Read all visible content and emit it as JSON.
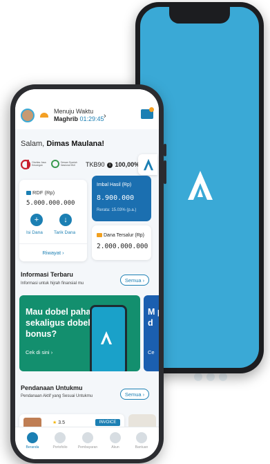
{
  "header": {
    "line1": "Menuju Waktu",
    "prayer": "Maghrib",
    "countdown": "01:29:45",
    "chevron": "›"
  },
  "greeting": {
    "prefix": "Salam,",
    "name": "Dimas Maulana!"
  },
  "licenses": {
    "ojk_text": "Otoritas Jasa Keuangan",
    "mui_text": "Dewan Syariah Nasional MUI"
  },
  "tkb": {
    "label": "TKB90",
    "info_icon": "i",
    "value": "100,00%"
  },
  "rdf": {
    "label": "RDF (Rp)",
    "value": "5.000.000.000",
    "isi_label": "Isi Dana",
    "tarik_label": "Tarik Dana",
    "riwayat": "Riwayat",
    "plus_glyph": "+",
    "down_glyph": "↓"
  },
  "imbal": {
    "label": "Imbal Hasil (Rp)",
    "value": "8.900.000",
    "rerata": "Rerata: 15.03% (p.a.)"
  },
  "tersalur": {
    "label": "Dana Tersalur (Rp)",
    "value": "2.000.000.000"
  },
  "info_section": {
    "title": "Informasi Terbaru",
    "subtitle": "Informasi untuk hijrah finansial mu",
    "all_label": "Semua"
  },
  "promo": {
    "text": "Mau dobel pahala sekaligus dobel bonus?",
    "cta": "Cek di sini",
    "peek_text": "M p d",
    "peek_cta": "Ce"
  },
  "funding_section": {
    "title": "Pendanaan Untukmu",
    "subtitle": "Pendanaan Aktif yang Sesuai Untukmu",
    "all_label": "Semua",
    "rating": "3.5",
    "badge": "INVOICE"
  },
  "bottom_nav": {
    "items": [
      {
        "label": "Beranda",
        "icon": "home-icon"
      },
      {
        "label": "Portofolio",
        "icon": "portfolio-icon"
      },
      {
        "label": "Pembayaran",
        "icon": "payment-icon"
      },
      {
        "label": "Akun",
        "icon": "account-icon"
      },
      {
        "label": "Bantuan",
        "icon": "help-icon"
      }
    ]
  },
  "colors": {
    "brand": "#1b7fb3",
    "splash": "#3aa9d6",
    "promo": "#138f6e"
  }
}
